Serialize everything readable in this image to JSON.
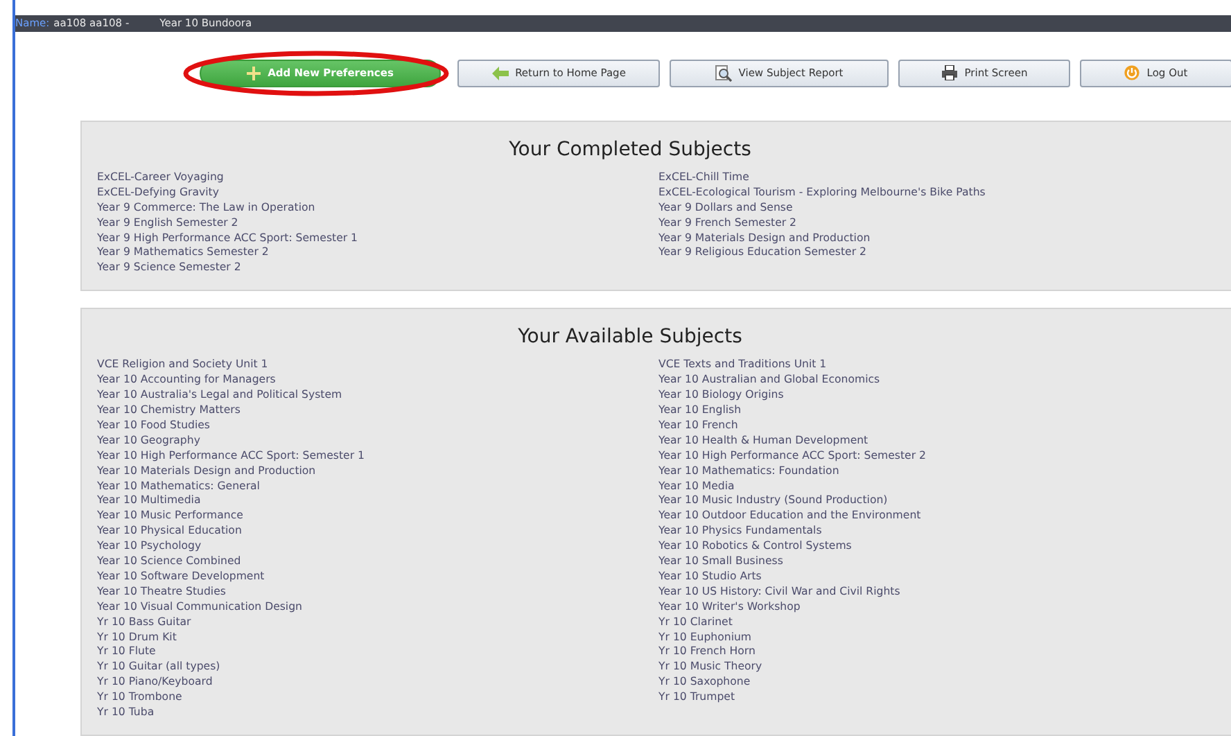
{
  "header": {
    "name_label": "Name:",
    "name_value": "aa108 aa108 -",
    "campus": "Year 10 Bundoora"
  },
  "buttons": [
    {
      "label": "Add New Preferences",
      "kind": "add",
      "highlighted": true
    },
    {
      "label": "Return to Home Page",
      "kind": "home",
      "highlighted": false
    },
    {
      "label": "View Subject Report",
      "kind": "report",
      "highlighted": false
    },
    {
      "label": "Print Screen",
      "kind": "print",
      "highlighted": false
    },
    {
      "label": "Log Out",
      "kind": "logout",
      "highlighted": false
    }
  ],
  "panels": [
    {
      "title": "Your Completed Subjects",
      "left": [
        "ExCEL-Career Voyaging",
        "ExCEL-Defying Gravity",
        "Year 9 Commerce: The Law in Operation",
        "Year 9 English Semester 2",
        "Year 9 High Performance ACC Sport: Semester 1",
        "Year 9 Mathematics Semester 2",
        "Year 9 Science Semester 2"
      ],
      "right": [
        "ExCEL-Chill Time",
        "ExCEL-Ecological Tourism - Exploring Melbourne's Bike Paths",
        "Year 9 Dollars and Sense",
        "Year 9 French Semester 2",
        "Year 9 Materials Design and Production",
        "Year 9 Religious Education Semester 2"
      ]
    },
    {
      "title": "Your Available Subjects",
      "left": [
        "VCE Religion and Society Unit 1",
        "Year 10 Accounting for Managers",
        "Year 10 Australia's Legal and Political System",
        "Year 10 Chemistry Matters",
        "Year 10 Food Studies",
        "Year 10 Geography",
        "Year 10 High Performance ACC Sport: Semester 1",
        "Year 10 Materials Design and Production",
        "Year 10 Mathematics: General",
        "Year 10 Multimedia",
        "Year 10 Music Performance",
        "Year 10 Physical Education",
        "Year 10 Psychology",
        "Year 10 Science Combined",
        "Year 10 Software Development",
        "Year 10 Theatre Studies",
        "Year 10 Visual Communication Design",
        "Yr 10 Bass Guitar",
        "Yr 10 Drum Kit",
        "Yr 10 Flute",
        "Yr 10 Guitar (all types)",
        "Yr 10 Piano/Keyboard",
        "Yr 10 Trombone",
        "Yr 10 Tuba"
      ],
      "right": [
        "VCE Texts and Traditions Unit 1",
        "Year 10 Australian and Global Economics",
        "Year 10 Biology Origins",
        "Year 10 English",
        "Year 10 French",
        "Year 10 Health & Human Development",
        "Year 10 High Performance ACC Sport: Semester 2",
        "Year 10 Mathematics: Foundation",
        "Year 10 Media",
        "Year 10 Music Industry (Sound Production)",
        "Year 10 Outdoor Education and the Environment",
        "Year 10 Physics Fundamentals",
        "Year 10 Robotics & Control Systems",
        "Year 10 Small Business",
        "Year 10 Studio Arts",
        "Year 10 US History: Civil War and Civil Rights",
        "Year 10 Writer's Workshop",
        "Yr 10 Clarinet",
        "Yr 10 Euphonium",
        "Yr 10 French Horn",
        "Yr 10 Music Theory",
        "Yr 10 Saxophone",
        "Yr 10 Trumpet"
      ]
    }
  ]
}
